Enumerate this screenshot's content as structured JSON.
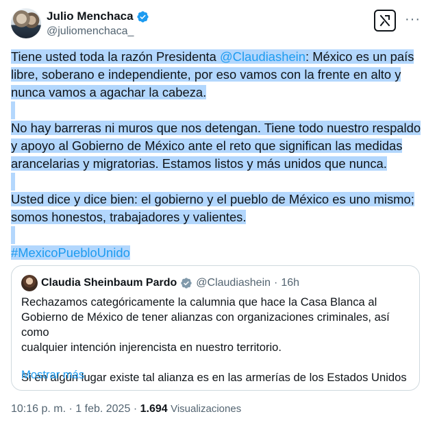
{
  "author": {
    "name": "Julio Menchaca",
    "handle": "@juliomenchaca_"
  },
  "tweet": {
    "p1_pre": "Tiene usted toda la razón Presidenta ",
    "p1_mention": "@Claudiashein",
    "p1_line1_post": ": México es un país",
    "p1_line2": "libre, soberano e independiente, por eso vamos con la frente en alto y",
    "p1_line3": "nunca vamos a agachar la cabeza.",
    "p2_line1": "No hay barreras ni muros que nos detengan. Tiene todo nuestro respaldo",
    "p2_line2": "y apoyo al Gobierno de México ante el reto que significan las medidas",
    "p2_line3": "arancelarias y migratorias. Estamos listos y más unidos que nunca.",
    "p3_line1": "Usted dice y dice bien: el gobierno y el pueblo de México es uno mismo;",
    "p3_line2": "somos honestos, trabajadores y valientes.",
    "hashtag": "#MexicoPuebloUnido"
  },
  "quote": {
    "name": "Claudia Sheinbaum Pardo",
    "handle": "@Claudiashein",
    "sep": "·",
    "time": "16h",
    "text_line1": "Rechazamos categóricamente la calumnia que hace la Casa Blanca al",
    "text_line2": "Gobierno de México de tener alianzas con organizaciones criminales, así como",
    "text_line3": "cualquier intención injerencista en nuestro territorio.",
    "text_line4": "Si en algún lugar existe tal alianza es en las armerías de los Estados Unidos",
    "show_more": "Mostrar más"
  },
  "meta": {
    "time": "10:16 p. m.",
    "sep1": "·",
    "date": "1 feb. 2025",
    "sep2": "·",
    "views_count": "1.694",
    "views_label": "Visualizaciones"
  },
  "icons": {
    "verified": "verified-badge-icon",
    "grok": "grok-icon",
    "more": "more-icon"
  },
  "colors": {
    "link": "#1d9bf0",
    "highlight": "#b3d7fd",
    "secondary_text": "#536471",
    "verified": "#1d9bf0"
  }
}
